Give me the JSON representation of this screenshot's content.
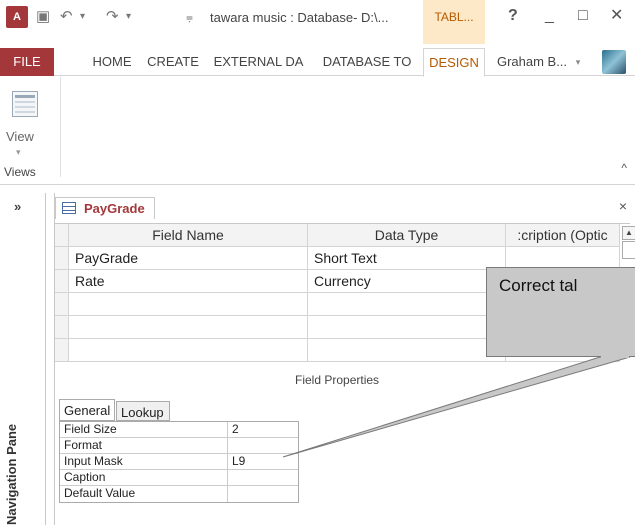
{
  "titlebar": {
    "app_icon": "A",
    "doc_title": "tawara music : Database- D:\\...",
    "context_tab": "TABL...",
    "help": "?",
    "minimize": "_",
    "restore": "□",
    "close": "✕"
  },
  "ribbon_tabs": [
    "FILE",
    "HOME",
    "CREATE",
    "EXTERNAL DA",
    "DATABASE TO",
    "DESIGN"
  ],
  "user_name": "Graham B...",
  "ribbon": {
    "view_label": "View",
    "group_label": "Views"
  },
  "nav_pane": {
    "expand": "»",
    "label": "Navigation Pane"
  },
  "document": {
    "tab_label": "PayGrade",
    "close": "×",
    "columns": [
      "Field Name",
      "Data Type",
      ":cription (Optic"
    ],
    "rows": [
      [
        "PayGrade",
        "Short Text",
        ""
      ],
      [
        "Rate",
        "Currency",
        ""
      ],
      [
        "",
        "",
        ""
      ],
      [
        "",
        "",
        ""
      ],
      [
        "",
        "",
        ""
      ]
    ],
    "field_properties_label": "Field Properties",
    "property_tabs": [
      "General",
      "Lookup"
    ],
    "properties": [
      {
        "name": "Field Size",
        "value": "2"
      },
      {
        "name": "Format",
        "value": ""
      },
      {
        "name": "Input Mask",
        "value": "L9"
      },
      {
        "name": "Caption",
        "value": ""
      },
      {
        "name": "Default Value",
        "value": ""
      }
    ]
  },
  "callout": {
    "text": "Correct tal"
  }
}
